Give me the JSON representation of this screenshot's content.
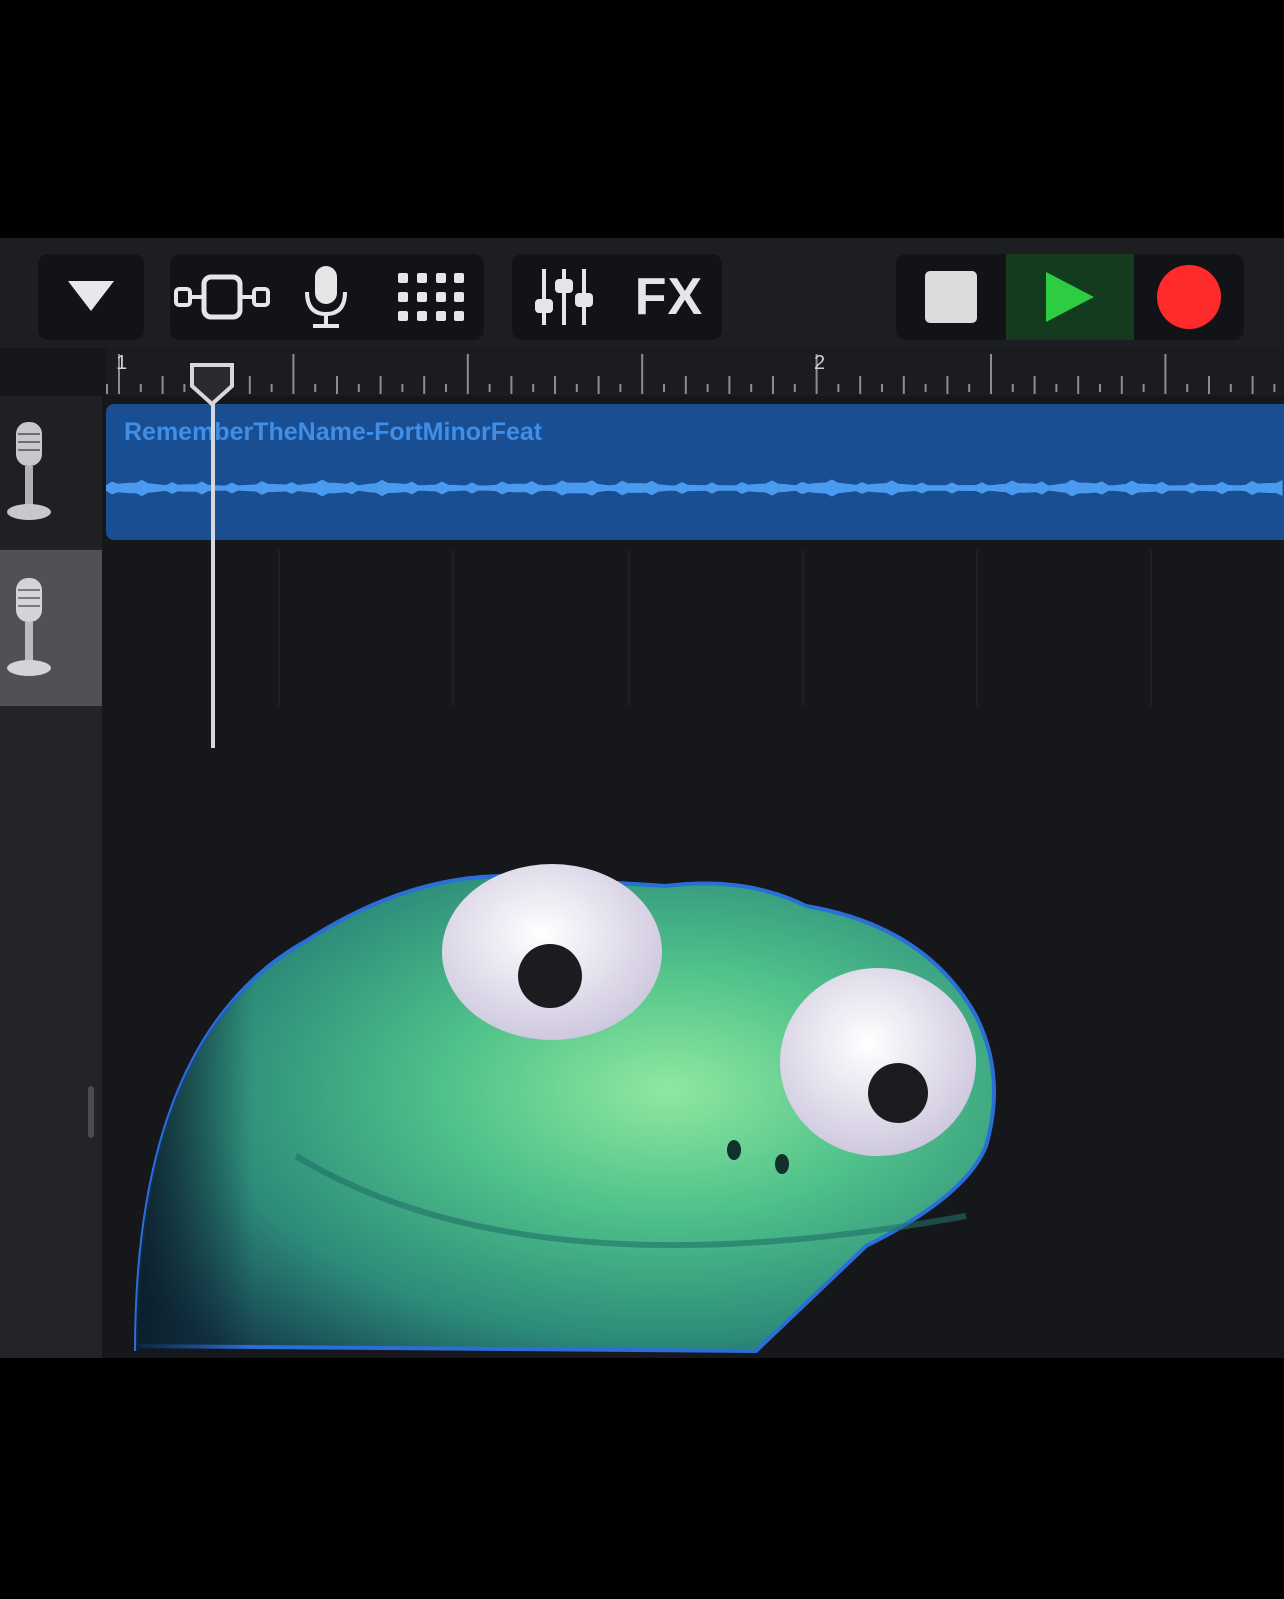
{
  "toolbar": {
    "buttons": [
      {
        "name": "menu-dropdown-icon"
      },
      {
        "name": "tracks-view-icon"
      },
      {
        "name": "microphone-icon"
      },
      {
        "name": "grid-icon"
      },
      {
        "name": "mixer-icon"
      },
      {
        "name": "fx-button",
        "label": "FX"
      },
      {
        "name": "stop-icon"
      },
      {
        "name": "play-icon"
      },
      {
        "name": "record-icon"
      }
    ],
    "fx_label": "FX"
  },
  "ruler": {
    "bar_1": "1",
    "bar_2": "2"
  },
  "tracks": [
    {
      "instrument_icon": "microphone-icon",
      "region_title": "RememberTheName-FortMinorFeat",
      "region_color": "#1a4e93"
    },
    {
      "instrument_icon": "microphone-icon",
      "selected": true
    }
  ],
  "colors": {
    "play": "#2ecc40",
    "record": "#ff2b2b",
    "region": "#1a4e93",
    "background": "#16171b"
  }
}
